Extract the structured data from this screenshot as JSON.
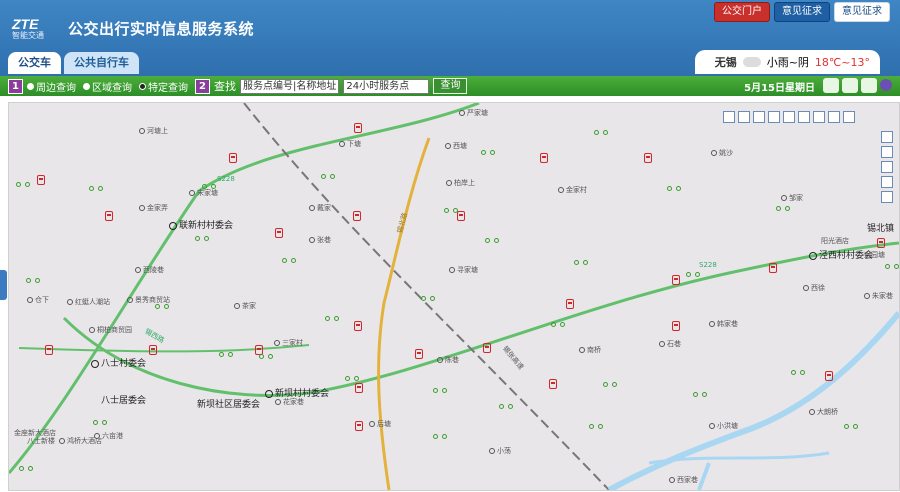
{
  "app": {
    "logo_text": "ZTE",
    "logo_sub": "智能交通",
    "title": "公交出行实时信息服务系统"
  },
  "top_buttons": [
    "公交门户",
    "意见征求",
    "意见征求"
  ],
  "tabs": [
    "公交车",
    "公共自行车"
  ],
  "weather": {
    "city": "无锡",
    "desc": "小雨~阴",
    "temp": "18℃~13°"
  },
  "toolbar": {
    "step1": "1",
    "options": [
      "周边查询",
      "区域查询",
      "特定查询"
    ],
    "selected_option": "特定查询",
    "step2": "2",
    "search_label": "查找",
    "search_value": "服务点编号|名称地址",
    "select_value": "24小时服务点",
    "query_button": "查询",
    "date": "5月15日星期日"
  },
  "map": {
    "labels": [
      "联新村村委会",
      "八士村委会",
      "八士居委会",
      "新坝村村委会",
      "新坝社区居委会",
      "锡北镇",
      "泾西村村委会"
    ],
    "road_labels": [
      "S228",
      "锡张高速",
      "锡北路",
      "锡西路",
      "S228"
    ],
    "pois": [
      "河塘上",
      "下塘",
      "严家塘",
      "西塘",
      "赵家",
      "戴家",
      "柏岸上",
      "仓下",
      "张巷",
      "宋家塘",
      "西陵巷",
      "茶家",
      "金家弄",
      "金家村",
      "姚沙",
      "邹家",
      "寻家塘",
      "八士居",
      "西徐",
      "朱家巷",
      "韩家巷",
      "南桥",
      "石巷",
      "陈巷",
      "六亩港",
      "花家巷",
      "后塘",
      "小荡",
      "小洪塘",
      "西家巷",
      "大朗桥",
      "三家村",
      "泥家",
      "高湖",
      "孙家",
      "东巷",
      "刘家",
      "小姚家",
      "庄家",
      "塘头",
      "庄桥",
      "杨家"
    ],
    "stations": [
      "红蜓人潮站",
      "景秀商贸站",
      "桐柏商贸园",
      "金座新大酒店",
      "八士新楼",
      "鸿桥大酒店",
      "阳光酒店",
      "兴园塘",
      "东巷"
    ]
  }
}
